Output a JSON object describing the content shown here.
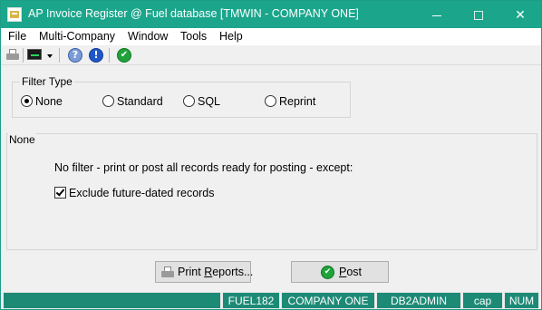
{
  "window": {
    "title": "AP Invoice Register @ Fuel database [TMWIN - COMPANY ONE]",
    "colors": {
      "titlebar": "#1ba68c",
      "statusbar": "#1d8a76"
    }
  },
  "menu": {
    "items": [
      "File",
      "Multi-Company",
      "Window",
      "Tools",
      "Help"
    ]
  },
  "toolbar": {
    "icons": [
      "printer-icon",
      "monitor-icon",
      "help-icon",
      "info-icon",
      "check-icon"
    ]
  },
  "filter_type": {
    "label": "Filter Type",
    "options": [
      "None",
      "Standard",
      "SQL",
      "Reprint"
    ],
    "selected": "None"
  },
  "panel": {
    "label": "None",
    "description": "No filter - print or post all records ready for posting - except:",
    "checkbox_label": "Exclude future-dated records",
    "checkbox_checked": true
  },
  "buttons": {
    "print_before": "Print ",
    "print_underline": "R",
    "print_after": "eports...",
    "post_underline": "P",
    "post_after": "ost"
  },
  "statusbar": {
    "segments": [
      "FUEL182",
      "COMPANY ONE",
      "DB2ADMIN",
      "cap",
      "NUM"
    ]
  }
}
